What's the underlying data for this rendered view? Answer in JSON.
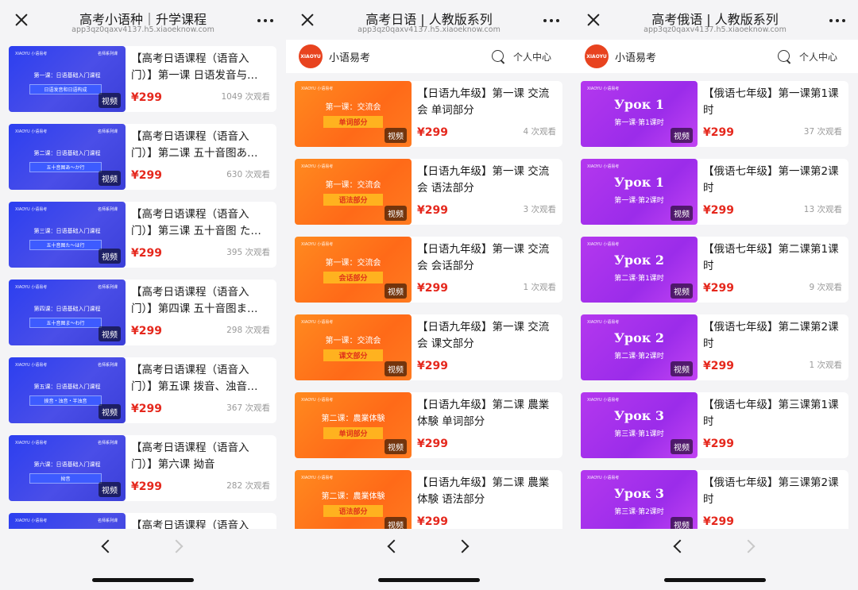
{
  "panels": [
    {
      "nav": {
        "title": "高考小语种｜升学课程",
        "url": "app3qz0qaxv4137.h5.xiaoeknow.com"
      },
      "forward_disabled": true,
      "items": [
        {
          "title": "【高考日语课程（语音入门）】第一课 日语发音与…",
          "price": "¥299",
          "views": "1049 次观看",
          "thumb_line1": "第一课：日语基础入门课程",
          "thumb_line2": "日语发音和日语构成"
        },
        {
          "title": "【高考日语课程（语音入门）】第二课 五十音图あ…",
          "price": "¥299",
          "views": "630 次观看",
          "thumb_line1": "第二课：日语基础入门课程",
          "thumb_line2": "五十音图あ～か行"
        },
        {
          "title": "【高考日语课程（语音入门）】第三课 五十音图 た…",
          "price": "¥299",
          "views": "395 次观看",
          "thumb_line1": "第三课：日语基础入门课程",
          "thumb_line2": "五十音图た～は行"
        },
        {
          "title": "【高考日语课程（语音入门）】第四课 五十音图ま…",
          "price": "¥299",
          "views": "298 次观看",
          "thumb_line1": "第四课：日语基础入门课程",
          "thumb_line2": "五十音图ま～わ行"
        },
        {
          "title": "【高考日语课程（语音入门）】第五课 拨音、浊音…",
          "price": "¥299",
          "views": "367 次观看",
          "thumb_line1": "第五课：日语基础入门课程",
          "thumb_line2": "拨音・浊音・半浊音"
        },
        {
          "title": "【高考日语课程（语音入门）】第六课 拗音",
          "price": "¥299",
          "views": "282 次观看",
          "thumb_line1": "第六课：日语基础入门课程",
          "thumb_line2": "拗音"
        },
        {
          "title": "【高考日语课程（语音入",
          "price": "",
          "views": "",
          "thumb_line1": "",
          "thumb_line2": ""
        }
      ],
      "thumb_style": "blue",
      "thumb_brand": "XIAOYU 小语易考",
      "thumb_teacher": "名师系列课",
      "badge": "视频"
    },
    {
      "nav": {
        "title": "高考日语 | 人教版系列",
        "url": "app3qz0qaxv4137.h5.xiaoeknow.com"
      },
      "shop": {
        "logo": "XIAOYU",
        "name": "小语易考",
        "personal": "个人中心"
      },
      "forward_disabled": false,
      "items": [
        {
          "title": "【日语九年级】第一课 交流会 单词部分",
          "price": "¥299",
          "views": "4 次观看",
          "thumb_line1": "第一课：交流会",
          "thumb_line2": "单词部分"
        },
        {
          "title": "【日语九年级】第一课 交流会 语法部分",
          "price": "¥299",
          "views": "3 次观看",
          "thumb_line1": "第一课：交流会",
          "thumb_line2": "语法部分"
        },
        {
          "title": "【日语九年级】第一课 交流会 会话部分",
          "price": "¥299",
          "views": "1 次观看",
          "thumb_line1": "第一课：交流会",
          "thumb_line2": "会话部分"
        },
        {
          "title": "【日语九年级】第一课 交流会 课文部分",
          "price": "¥299",
          "views": "",
          "thumb_line1": "第一课：交流会",
          "thumb_line2": "课文部分"
        },
        {
          "title": "【日语九年级】第二课 農業体験 单词部分",
          "price": "¥299",
          "views": "",
          "thumb_line1": "第二课：農業体験",
          "thumb_line2": "单词部分"
        },
        {
          "title": "【日语九年级】第二课 農業体験 语法部分",
          "price": "¥299",
          "views": "",
          "thumb_line1": "第二课：農業体験",
          "thumb_line2": "语法部分"
        }
      ],
      "thumb_style": "orange",
      "thumb_brand": "XIAOYU 小语易考",
      "badge": "视频"
    },
    {
      "nav": {
        "title": "高考俄语 | 人教版系列",
        "url": "app3qz0qaxv4137.h5.xiaoeknow.com"
      },
      "shop": {
        "logo": "XIAOYU",
        "name": "小语易考",
        "personal": "个人中心"
      },
      "forward_disabled": true,
      "items": [
        {
          "title": "【俄语七年级】第一课第1课时",
          "price": "¥299",
          "views": "37 次观看",
          "thumb_line1": "Урок 1",
          "thumb_line2": "第一课·第1课时"
        },
        {
          "title": "【俄语七年级】第一课第2课时",
          "price": "¥299",
          "views": "13 次观看",
          "thumb_line1": "Урок 1",
          "thumb_line2": "第一课·第2课时"
        },
        {
          "title": "【俄语七年级】第二课第1课时",
          "price": "¥299",
          "views": "9 次观看",
          "thumb_line1": "Урок 2",
          "thumb_line2": "第二课·第1课时"
        },
        {
          "title": "【俄语七年级】第二课第2课时",
          "price": "¥299",
          "views": "1 次观看",
          "thumb_line1": "Урок 2",
          "thumb_line2": "第二课·第2课时"
        },
        {
          "title": "【俄语七年级】第三课第1课时",
          "price": "¥299",
          "views": "",
          "thumb_line1": "Урок 3",
          "thumb_line2": "第三课·第1课时"
        },
        {
          "title": "【俄语七年级】第三课第2课时",
          "price": "¥299",
          "views": "",
          "thumb_line1": "Урок 3",
          "thumb_line2": "第三课·第2课时"
        }
      ],
      "thumb_style": "purple",
      "thumb_brand": "XIAOYU 小语易考",
      "badge": "视频"
    }
  ]
}
